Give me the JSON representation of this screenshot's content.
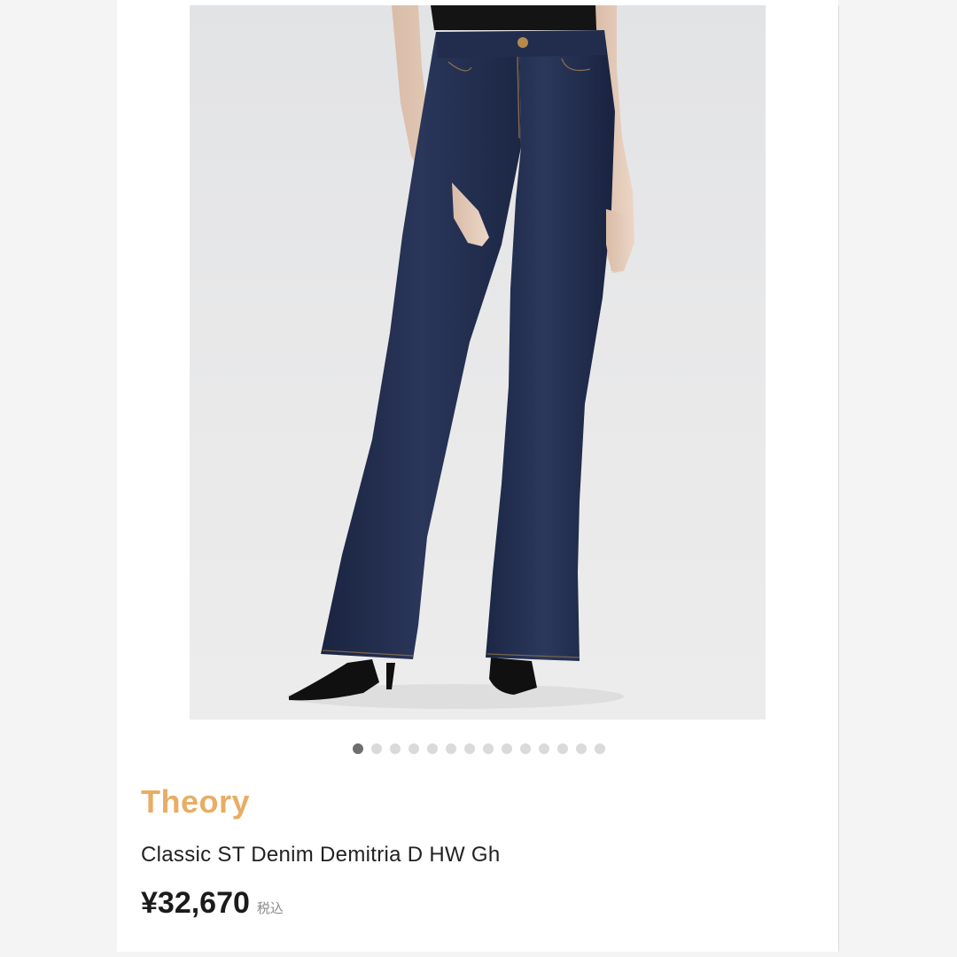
{
  "product": {
    "image_alt": "Model wearing dark indigo high-waist flare denim with black pointed heels",
    "carousel": {
      "total": 14,
      "active_index": 0
    },
    "brand": "Theory",
    "name": "Classic ST Denim Demitria D HW Gh",
    "price": "¥32,670",
    "tax_note": "税込"
  },
  "colors": {
    "brand": "#e8ad64",
    "denim": "#1e2a4a",
    "background": "#f4f4f4"
  }
}
